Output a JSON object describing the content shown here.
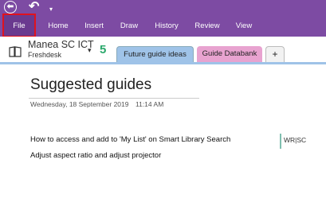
{
  "quick_access": {
    "back_icon": "⬅",
    "undo_icon": "↶",
    "more_icon": "▾"
  },
  "ribbon": {
    "tabs": [
      "File",
      "Home",
      "Insert",
      "Draw",
      "History",
      "Review",
      "View"
    ]
  },
  "notebook": {
    "name": "Manea SC ICT",
    "section_group": "Freshdesk",
    "dropdown_icon": "▾",
    "sync_icon": "5"
  },
  "section_tabs": [
    "Future guide ideas",
    "Guide Databank",
    "+"
  ],
  "page": {
    "title": "Suggested guides",
    "date": "Wednesday, 18 September 2019",
    "time": "11:14 AM",
    "lines": [
      "How to access and add to 'My List' on Smart Library Search",
      "Adjust aspect ratio and adjust projector"
    ],
    "author_tag": "WR|SC"
  },
  "colors": {
    "ribbon": "#7d4ba3",
    "active_section": "#9fc3e8",
    "other_section": "#e8a3d0",
    "highlight": "#e0121e"
  }
}
